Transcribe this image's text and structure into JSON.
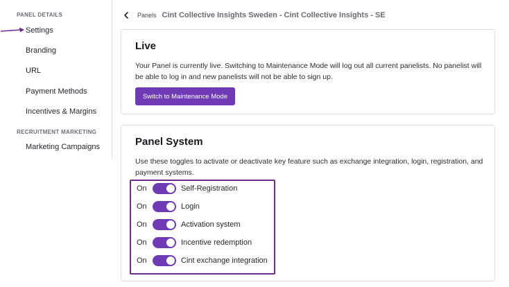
{
  "sidebar": {
    "section_panel_details": "PANEL DETAILS",
    "section_recruitment": "RECRUITMENT MARKETING",
    "items": [
      {
        "label": "Settings",
        "active": true
      },
      {
        "label": "Branding"
      },
      {
        "label": "URL"
      },
      {
        "label": "Payment Methods"
      },
      {
        "label": "Incentives & Margins"
      },
      {
        "label": "Marketing Campaigns"
      }
    ]
  },
  "breadcrumb": {
    "parent": "Panels",
    "current": "Cint Collective Insights Sweden - Cint Collective Insights - SE"
  },
  "live": {
    "title": "Live",
    "description": "Your Panel is currently live. Switching to Maintenance Mode will log out all current panelists. No panelist will be able to log in and new panelists will not be able to sign up.",
    "button": "Switch to Maintenance Mode"
  },
  "panel_system": {
    "title": "Panel System",
    "description": "Use these toggles to activate or deactivate key feature such as exchange integration, login, registration, and payment systems.",
    "toggles": [
      {
        "state": "On",
        "label": "Self-Registration"
      },
      {
        "state": "On",
        "label": "Login"
      },
      {
        "state": "On",
        "label": "Activation system"
      },
      {
        "state": "On",
        "label": "Incentive redemption"
      },
      {
        "state": "On",
        "label": "Cint exchange integration"
      }
    ]
  },
  "colors": {
    "accent": "#6f3bb5",
    "highlight_border": "#6e2a8e",
    "arrow": "#6e2a8e"
  }
}
